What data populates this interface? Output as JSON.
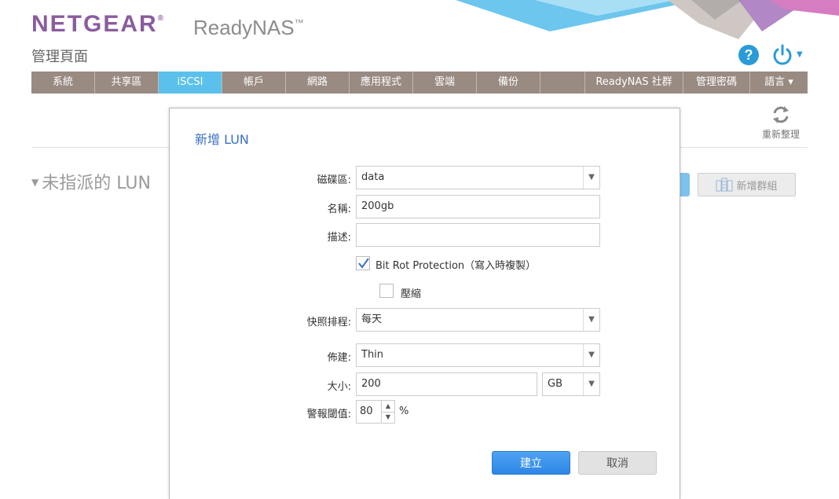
{
  "header": {
    "brand": "NETGEAR",
    "brand_mark": "®",
    "product": "ReadyNAS",
    "product_mark": "™",
    "subtitle": "管理頁面",
    "help_icon": "question-icon",
    "power_icon": "power-icon",
    "accent_color": "#2a9bd8",
    "brand_color": "#8a5c9e"
  },
  "nav": {
    "tabs": [
      {
        "label": "系統"
      },
      {
        "label": "共享區"
      },
      {
        "label": "iSCSI",
        "active": true
      },
      {
        "label": "帳戶"
      },
      {
        "label": "網路"
      },
      {
        "label": "應用程式"
      },
      {
        "label": "雲端"
      },
      {
        "label": "備份"
      },
      {
        "label": ""
      },
      {
        "label": "ReadyNAS 社群"
      },
      {
        "label": "管理密碼"
      },
      {
        "label": "語言 ▾"
      }
    ],
    "active_color": "#5bc1ec",
    "bar_color": "#998a82"
  },
  "toolbar": {
    "reorganize_label": "重新整理"
  },
  "main": {
    "section_title": "未指派的 LUN",
    "add_group_label": "新增群組"
  },
  "dialog": {
    "title": "新增 LUN",
    "volume": {
      "label": "磁碟區:",
      "value": "data"
    },
    "name": {
      "label": "名稱:",
      "value": "200gb"
    },
    "description": {
      "label": "描述:",
      "value": ""
    },
    "bit_rot": {
      "label": "Bit Rot Protection（寫入時複製）",
      "checked": true
    },
    "compression": {
      "label": "壓縮",
      "checked": false
    },
    "snapshot": {
      "label": "快照排程:",
      "value": "每天"
    },
    "provisioning": {
      "label": "佈建:",
      "value": "Thin"
    },
    "size": {
      "label": "大小:",
      "value": "200",
      "unit": "GB"
    },
    "alert": {
      "label": "警報閾值:",
      "value": "80",
      "unit": "%"
    },
    "create_label": "建立",
    "cancel_label": "取消"
  }
}
